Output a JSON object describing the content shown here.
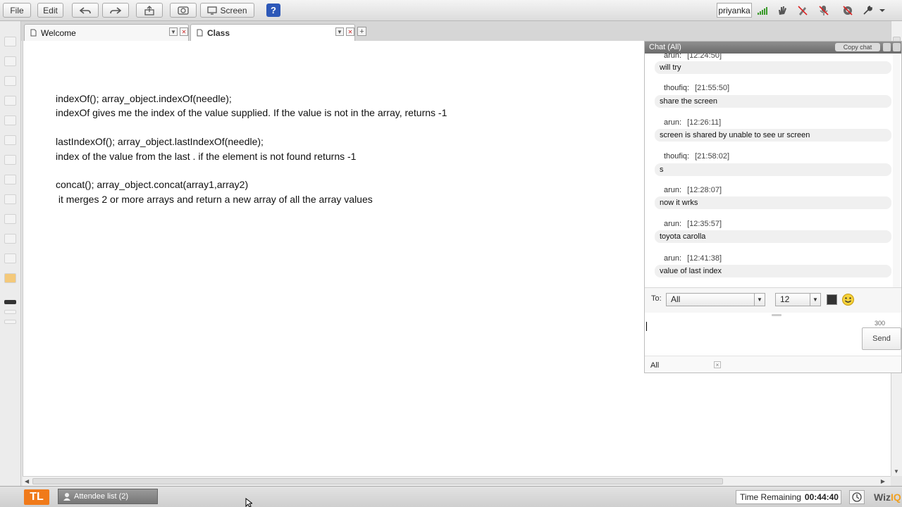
{
  "toolbar": {
    "file": "File",
    "edit": "Edit",
    "screen": "Screen",
    "help": "?",
    "user": "priyanka"
  },
  "tabs": [
    {
      "label": "Welcome"
    },
    {
      "label": "Class"
    }
  ],
  "whiteboard": {
    "text": "indexOf(); array_object.indexOf(needle);\nindexOf gives me the index of the value supplied. If the value is not in the array, returns -1\n\nlastIndexOf(); array_object.lastIndexOf(needle);\nindex of the value from the last . if the element is not found returns -1\n\nconcat(); array_object.concat(array1,array2)\n it merges 2 or more arrays and return a new array of all the array values"
  },
  "chat": {
    "title": "Chat (All)",
    "copy_label": "Copy chat",
    "messages": [
      {
        "user": "arun:",
        "time": "[12:24:50]",
        "text": "will try"
      },
      {
        "user": "thoufiq:",
        "time": "[21:55:50]",
        "text": "share the screen"
      },
      {
        "user": "arun:",
        "time": "[12:26:11]",
        "text": "screen is shared by unable to see ur screen"
      },
      {
        "user": "thoufiq:",
        "time": "[21:58:02]",
        "text": "s"
      },
      {
        "user": "arun:",
        "time": "[12:28:07]",
        "text": "now it wrks"
      },
      {
        "user": "arun:",
        "time": "[12:35:57]",
        "text": "toyota carolla"
      },
      {
        "user": "arun:",
        "time": "[12:41:38]",
        "text": "value of last index"
      }
    ],
    "to_label": "To:",
    "to_value": "All",
    "font_size": "12",
    "char_count": "300",
    "send_label": "Send",
    "filter": "All"
  },
  "statusbar": {
    "logo": "TL",
    "attendee": "Attendee list (2)",
    "time_label": "Time Remaining",
    "time_value": "00:44:40",
    "brand_a": "Wiz",
    "brand_b": "IQ"
  }
}
